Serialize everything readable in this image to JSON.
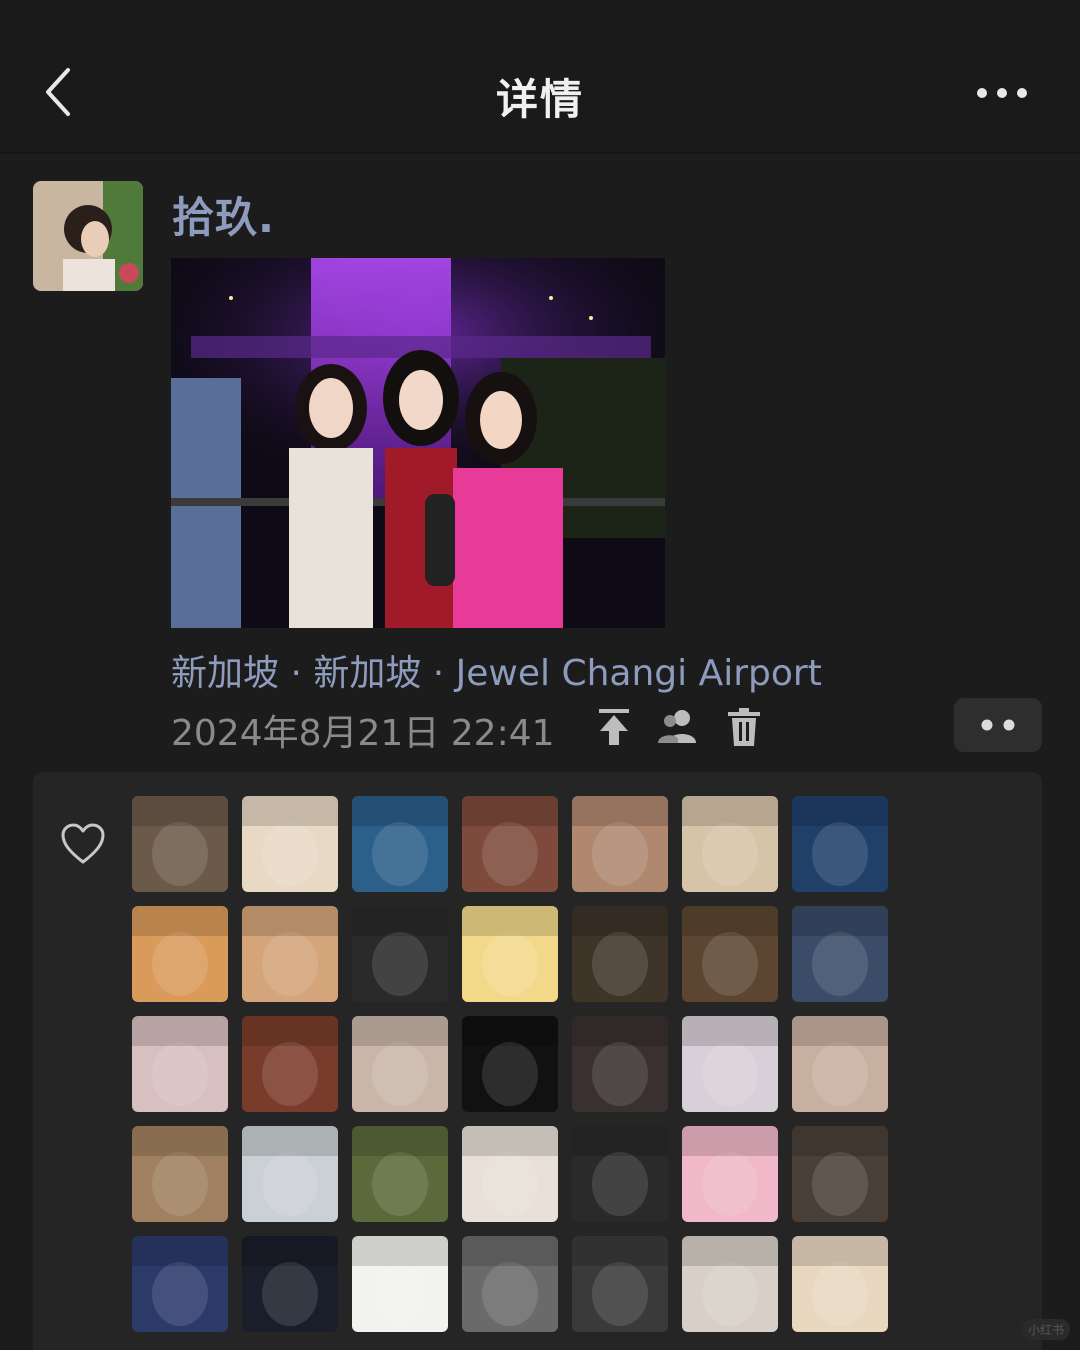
{
  "navbar": {
    "title": "详情",
    "back_icon": "chevron-left-icon",
    "more_icon": "ellipsis-icon"
  },
  "post": {
    "nickname": "拾玖.",
    "location": "新加坡 · 新加坡 · Jewel Changi Airport",
    "timestamp": "2024年8月21日 22:41",
    "tools": [
      "pin-top-icon",
      "visibility-people-icon",
      "trash-icon"
    ],
    "comment_button_icon": "two-dots-icon"
  },
  "likes": {
    "icon": "heart-icon",
    "avatar_colors": [
      [
        "#6b5a4a",
        "#e8d9c4",
        "#2c5f8a",
        "#7d4a3b",
        "#b08870",
        "#d6c4a8",
        "#20406a"
      ],
      [
        "#d99a5a",
        "#d4a47a",
        "#2a2a2a",
        "#f2d98a",
        "#3e3428",
        "#5c4632",
        "#3a4c68"
      ],
      [
        "#d8c0c0",
        "#7a3c2a",
        "#c9b6a8",
        "#111111",
        "#3a3030",
        "#d8d0d8",
        "#c8b0a0"
      ],
      [
        "#a08060",
        "#cbd0d4",
        "#5a6a3a",
        "#e8e0d8",
        "#2a2a2a",
        "#f0b8c8",
        "#4a4038"
      ],
      [
        "#2c3a6a",
        "#1a1e2a",
        "#f2f2ee",
        "#6a6a6a",
        "#3a3a3a",
        "#d8d0c8",
        "#e8d8c0"
      ]
    ]
  },
  "watermark": "小红书"
}
